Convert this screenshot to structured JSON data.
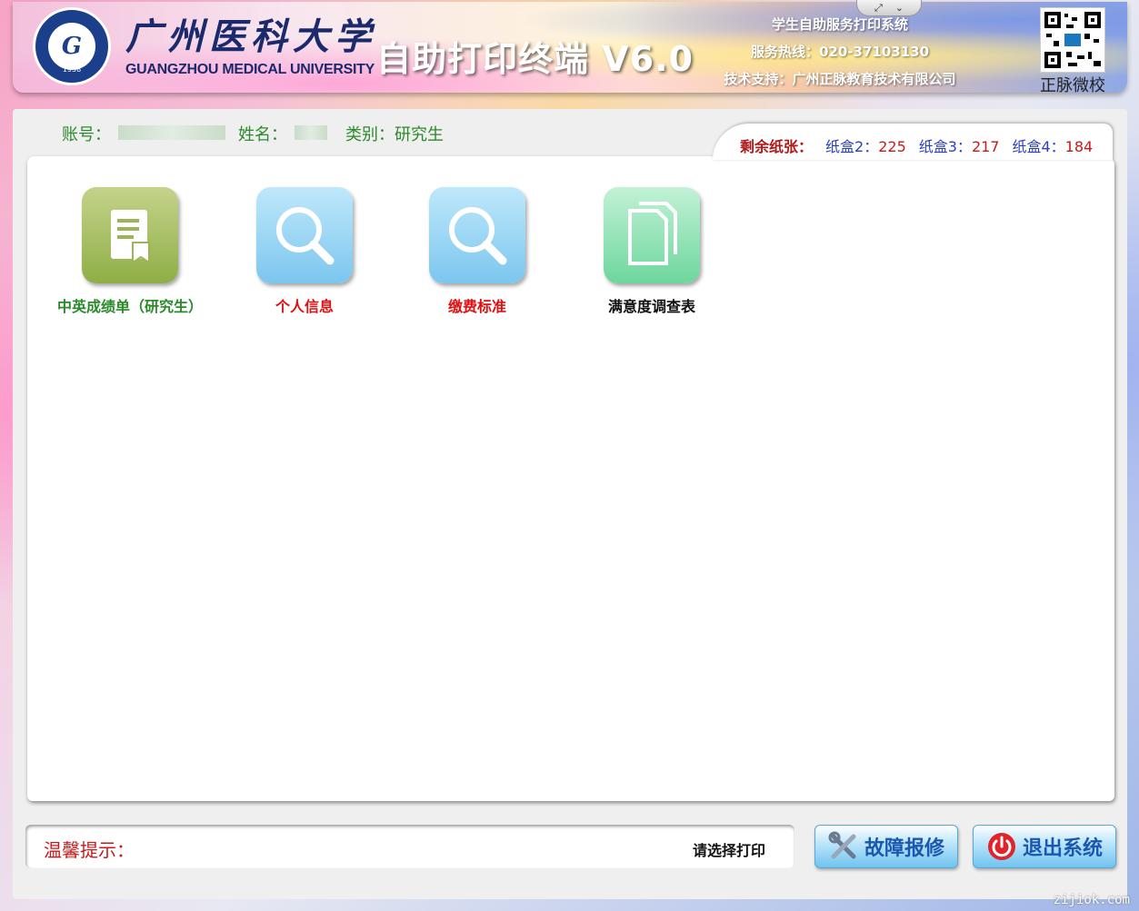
{
  "header": {
    "university_cn": "广州医科大学",
    "university_en": "GUANGZHOU MEDICAL UNIVERSITY",
    "logo_year": "1958",
    "app_title": "自助打印终端 V6.0",
    "system_name": "学生自助服务打印系统",
    "hotline": "服务热线：020-37103130",
    "support": "技术支持：广州正脉教育技术有限公司",
    "qr_label": "正脉微校"
  },
  "user": {
    "account_label": "账号：",
    "name_label": "姓名：",
    "category": "类别：研究生"
  },
  "paper": {
    "label": "剩余纸张：",
    "boxes": [
      {
        "name": "纸盒2：",
        "value": "225"
      },
      {
        "name": "纸盒3：",
        "value": "217"
      },
      {
        "name": "纸盒4：",
        "value": "184"
      }
    ]
  },
  "tiles": [
    {
      "label": "中英成绩单（研究生）",
      "icon": "document-ribbon-icon"
    },
    {
      "label": "个人信息",
      "icon": "magnifier-icon"
    },
    {
      "label": "缴费标准",
      "icon": "magnifier-icon"
    },
    {
      "label": "满意度调查表",
      "icon": "documents-icon"
    }
  ],
  "tip": {
    "label": "温馨提示：",
    "message": "请选择打印"
  },
  "buttons": {
    "repair": "故障报修",
    "exit": "退出系统"
  },
  "watermark": "zijiok.com",
  "colors": {
    "green": "#2b8a2b",
    "red": "#e01010",
    "blue": "#1a57b0"
  }
}
